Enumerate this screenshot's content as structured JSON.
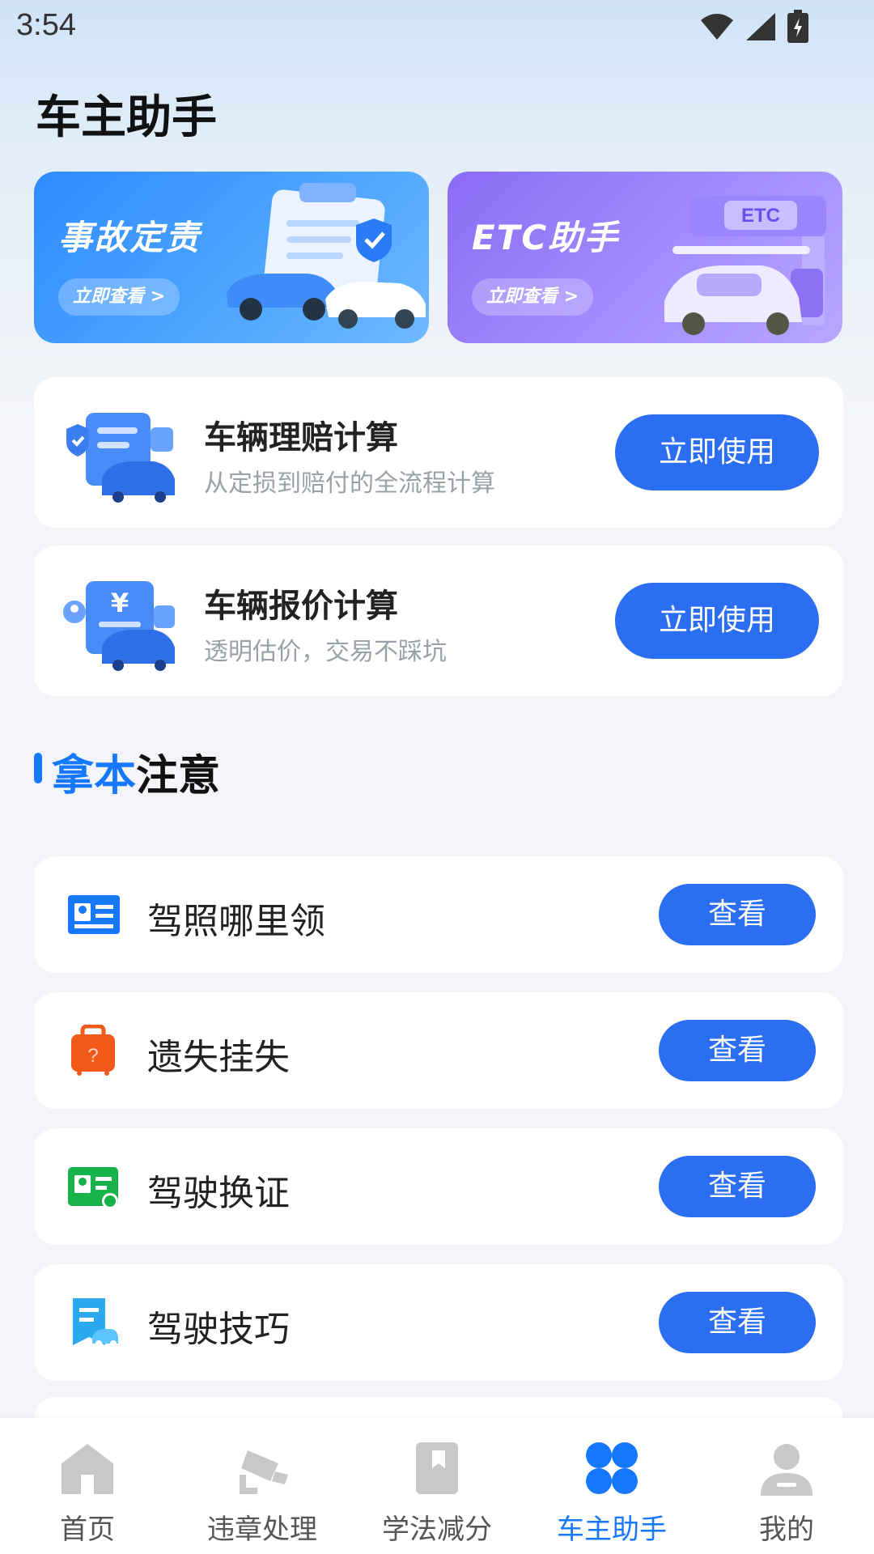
{
  "status_bar": {
    "time": "3:54"
  },
  "page_title": "车主助手",
  "banners": [
    {
      "title": "事故定责",
      "button": "立即查看 >"
    },
    {
      "title": "ETC助手",
      "button": "立即查看 >",
      "badge": "ETC"
    }
  ],
  "tools": [
    {
      "title": "车辆理赔计算",
      "subtitle": "从定损到赔付的全流程计算",
      "button": "立即使用"
    },
    {
      "title": "车辆报价计算",
      "subtitle": "透明估价，交易不踩坑",
      "button": "立即使用"
    }
  ],
  "section": {
    "title_accent": "拿本",
    "title_rest": "注意"
  },
  "list_items": [
    {
      "label": "驾照哪里领",
      "button": "查看",
      "icon": "license-icon",
      "color": "#1677ff"
    },
    {
      "label": "遗失挂失",
      "button": "查看",
      "icon": "lost-bag-icon",
      "color": "#f25a1a"
    },
    {
      "label": "驾驶换证",
      "button": "查看",
      "icon": "renew-license-icon",
      "color": "#18b24b"
    },
    {
      "label": "驾驶技巧",
      "button": "查看",
      "icon": "driving-tips-icon",
      "color": "#2aa8f0"
    }
  ],
  "nav": [
    {
      "label": "首页",
      "icon": "home-icon"
    },
    {
      "label": "违章处理",
      "icon": "camera-icon"
    },
    {
      "label": "学法减分",
      "icon": "book-icon"
    },
    {
      "label": "车主助手",
      "icon": "grid-icon",
      "active": true
    },
    {
      "label": "我的",
      "icon": "user-icon"
    }
  ],
  "colors": {
    "primary": "#2b6ef2",
    "accent": "#1677ff",
    "inactive_icon": "#c8c8c8"
  }
}
